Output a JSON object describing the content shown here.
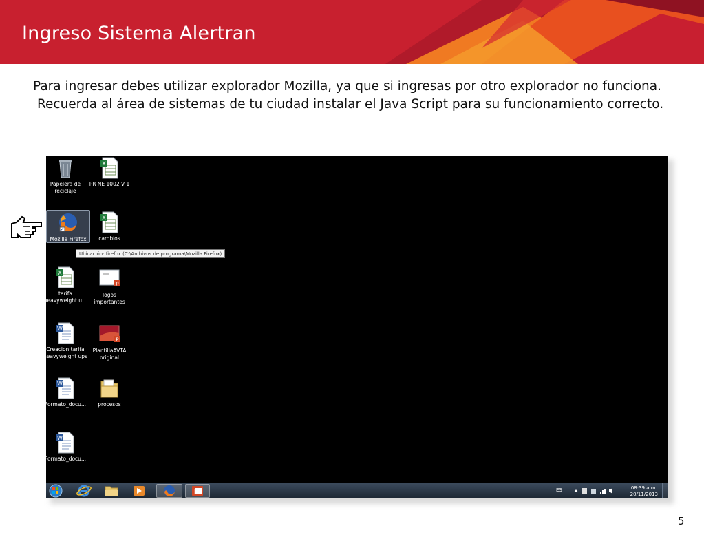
{
  "slide": {
    "title": "Ingreso Sistema Alertran",
    "paragraph_1": "Para ingresar debes utilizar explorador Mozilla, ya que si ingresas por otro explorador no funciona.",
    "paragraph_2": "Recuerda al área de sistemas de tu ciudad instalar el Java Script para su funcionamiento correcto.",
    "page_number": "5",
    "colors": {
      "banner_red": "#c8202f",
      "banner_orange": "#f07a22",
      "desktop_bg": "#000000"
    }
  },
  "desktop": {
    "icons": [
      {
        "name": "recycle-bin",
        "label": "Papelera de reciclaje",
        "icon": "recycle-bin-icon"
      },
      {
        "name": "pr-ne",
        "label": "PR NE 1002  V 1",
        "icon": "excel-file-icon"
      },
      {
        "name": "mozilla-firefox",
        "label": "Mozilla Firefox",
        "icon": "firefox-icon",
        "selected": true
      },
      {
        "name": "cambios",
        "label": "cambios",
        "icon": "excel-file-icon"
      },
      {
        "name": "tarifa",
        "label": "tarifa heavyweight u...",
        "icon": "excel-file-icon"
      },
      {
        "name": "logos-importantes",
        "label": "logos importantes",
        "icon": "powerpoint-file-icon"
      },
      {
        "name": "creacion-tarifa",
        "label": "Creacion tarifa heavyweight ups",
        "icon": "word-file-icon"
      },
      {
        "name": "plantilla-avta",
        "label": "PlantillaAVTA original",
        "icon": "powerpoint-file-icon"
      },
      {
        "name": "formato-docu-1",
        "label": "Formato_docu...",
        "icon": "word-file-icon"
      },
      {
        "name": "procesos",
        "label": "procesos",
        "icon": "folder-icon"
      },
      {
        "name": "formato-docu-2",
        "label": "Formato_docu...",
        "icon": "word-file-icon"
      }
    ],
    "tooltip": "Ubicación: firefox (C:\\Archivos de programa\\Mozilla Firefox)"
  },
  "taskbar": {
    "items": [
      "start-orb-icon",
      "internet-explorer-icon",
      "explorer-folder-icon",
      "media-player-icon",
      "firefox-icon",
      "powerpoint-icon"
    ],
    "active_item": "firefox-icon",
    "language": "ES",
    "time": "08:39 a.m.",
    "date": "20/11/2013"
  }
}
